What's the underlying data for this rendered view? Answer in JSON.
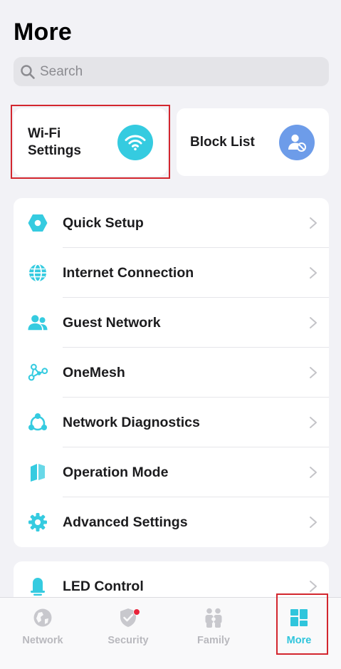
{
  "header": {
    "title": "More"
  },
  "search": {
    "placeholder": "Search",
    "value": ""
  },
  "tiles": [
    {
      "label": "Wi-Fi Settings",
      "icon": "wifi-icon",
      "color": "#35cbe0"
    },
    {
      "label": "Block List",
      "icon": "block-user-icon",
      "color": "#6d9ce9"
    }
  ],
  "menu": {
    "items": [
      {
        "label": "Quick Setup",
        "icon": "hexagon-icon"
      },
      {
        "label": "Internet Connection",
        "icon": "globe-icon"
      },
      {
        "label": "Guest Network",
        "icon": "guests-icon"
      },
      {
        "label": "OneMesh",
        "icon": "mesh-icon"
      },
      {
        "label": "Network Diagnostics",
        "icon": "diagnostics-icon"
      },
      {
        "label": "Operation Mode",
        "icon": "map-icon"
      },
      {
        "label": "Advanced Settings",
        "icon": "gear-icon"
      }
    ]
  },
  "led": {
    "label": "LED Control",
    "icon": "bulb-icon"
  },
  "tabbar": {
    "tabs": [
      {
        "label": "Network",
        "icon": "globe-icon",
        "active": false
      },
      {
        "label": "Security",
        "icon": "shield-check-icon",
        "active": false,
        "badge": true
      },
      {
        "label": "Family",
        "icon": "family-icon",
        "active": false
      },
      {
        "label": "More",
        "icon": "grid-icon",
        "active": true
      }
    ]
  },
  "colors": {
    "accent": "#35cbe0",
    "highlight": "#d3262e",
    "inactive": "#b9b9be"
  }
}
